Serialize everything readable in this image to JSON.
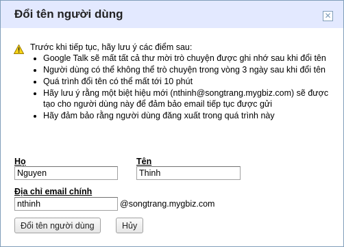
{
  "dialog": {
    "title": "Đổi tên người dùng",
    "close_label": "✕"
  },
  "warning": {
    "intro": "Trước khi tiếp tục, hãy lưu ý các điểm sau:",
    "items": [
      "Google Talk sẽ mất tất cả thư mời trò chuyện được ghi nhớ sau khi đổi tên",
      "Người dùng có thể không thể trò chuyện trong vòng 3 ngày sau khi đổi tên",
      "Quá trình đổi tên có thể mất tới 10 phút",
      "Hãy lưu ý rằng một biệt hiệu mới (nthinh@songtrang.mygbiz.com) sẽ được tạo cho người dùng này để đảm bảo email tiếp tục được gửi",
      "Hãy đảm bảo rằng người dùng đăng xuất trong quá trình này"
    ]
  },
  "form": {
    "last_name_label": "Họ",
    "last_name_value": "Nguyen",
    "first_name_label": "Tên",
    "first_name_value": "Thinh",
    "email_label": "Địa chỉ email chính",
    "email_value": "nthinh",
    "email_domain": "@songtrang.mygbiz.com"
  },
  "buttons": {
    "rename": "Đổi tên người dùng",
    "cancel": "Hủy"
  },
  "icons": {
    "warning": "warning-icon",
    "close": "close-icon"
  }
}
